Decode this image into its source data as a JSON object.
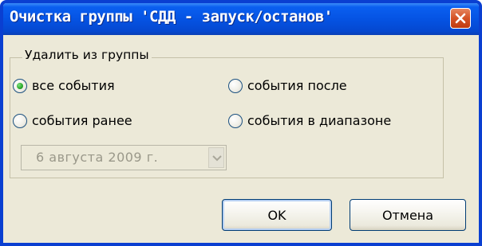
{
  "window": {
    "title": "Очистка группы 'СДД - запуск/останов'",
    "close_icon": "close-x-icon"
  },
  "group": {
    "legend": "Удалить из группы",
    "options": [
      {
        "label": "все события",
        "checked": true
      },
      {
        "label": "события после",
        "checked": false
      },
      {
        "label": "события ранее",
        "checked": false
      },
      {
        "label": "события в диапазоне",
        "checked": false
      }
    ],
    "date_value": "6  августа  2009 г.",
    "date_enabled": false
  },
  "buttons": {
    "ok_label": "OK",
    "cancel_label": "Отмена"
  },
  "colors": {
    "titlebar": "#0553e3",
    "window_bg": "#ece9d8",
    "close_button": "#d45226",
    "radio_checked": "#29a829"
  }
}
